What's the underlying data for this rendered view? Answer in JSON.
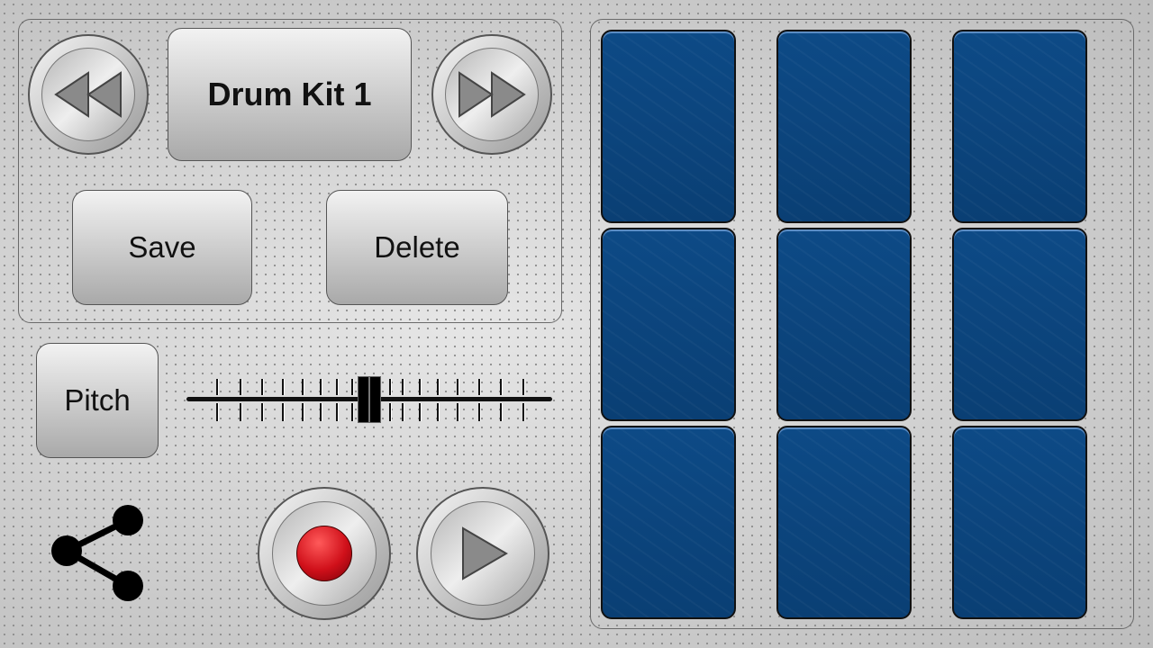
{
  "kit": {
    "name": "Drum Kit 1",
    "prev_icon": "rewind-icon",
    "next_icon": "fast-forward-icon"
  },
  "actions": {
    "save": "Save",
    "delete": "Delete"
  },
  "pitch": {
    "label": "Pitch",
    "value_fraction": 0.5
  },
  "transport": {
    "record_icon": "record-icon",
    "play_icon": "play-icon",
    "record_color": "#d0101a"
  },
  "share_icon": "share-icon",
  "pads": {
    "rows": 3,
    "cols": 3,
    "color": "#0b4580"
  }
}
